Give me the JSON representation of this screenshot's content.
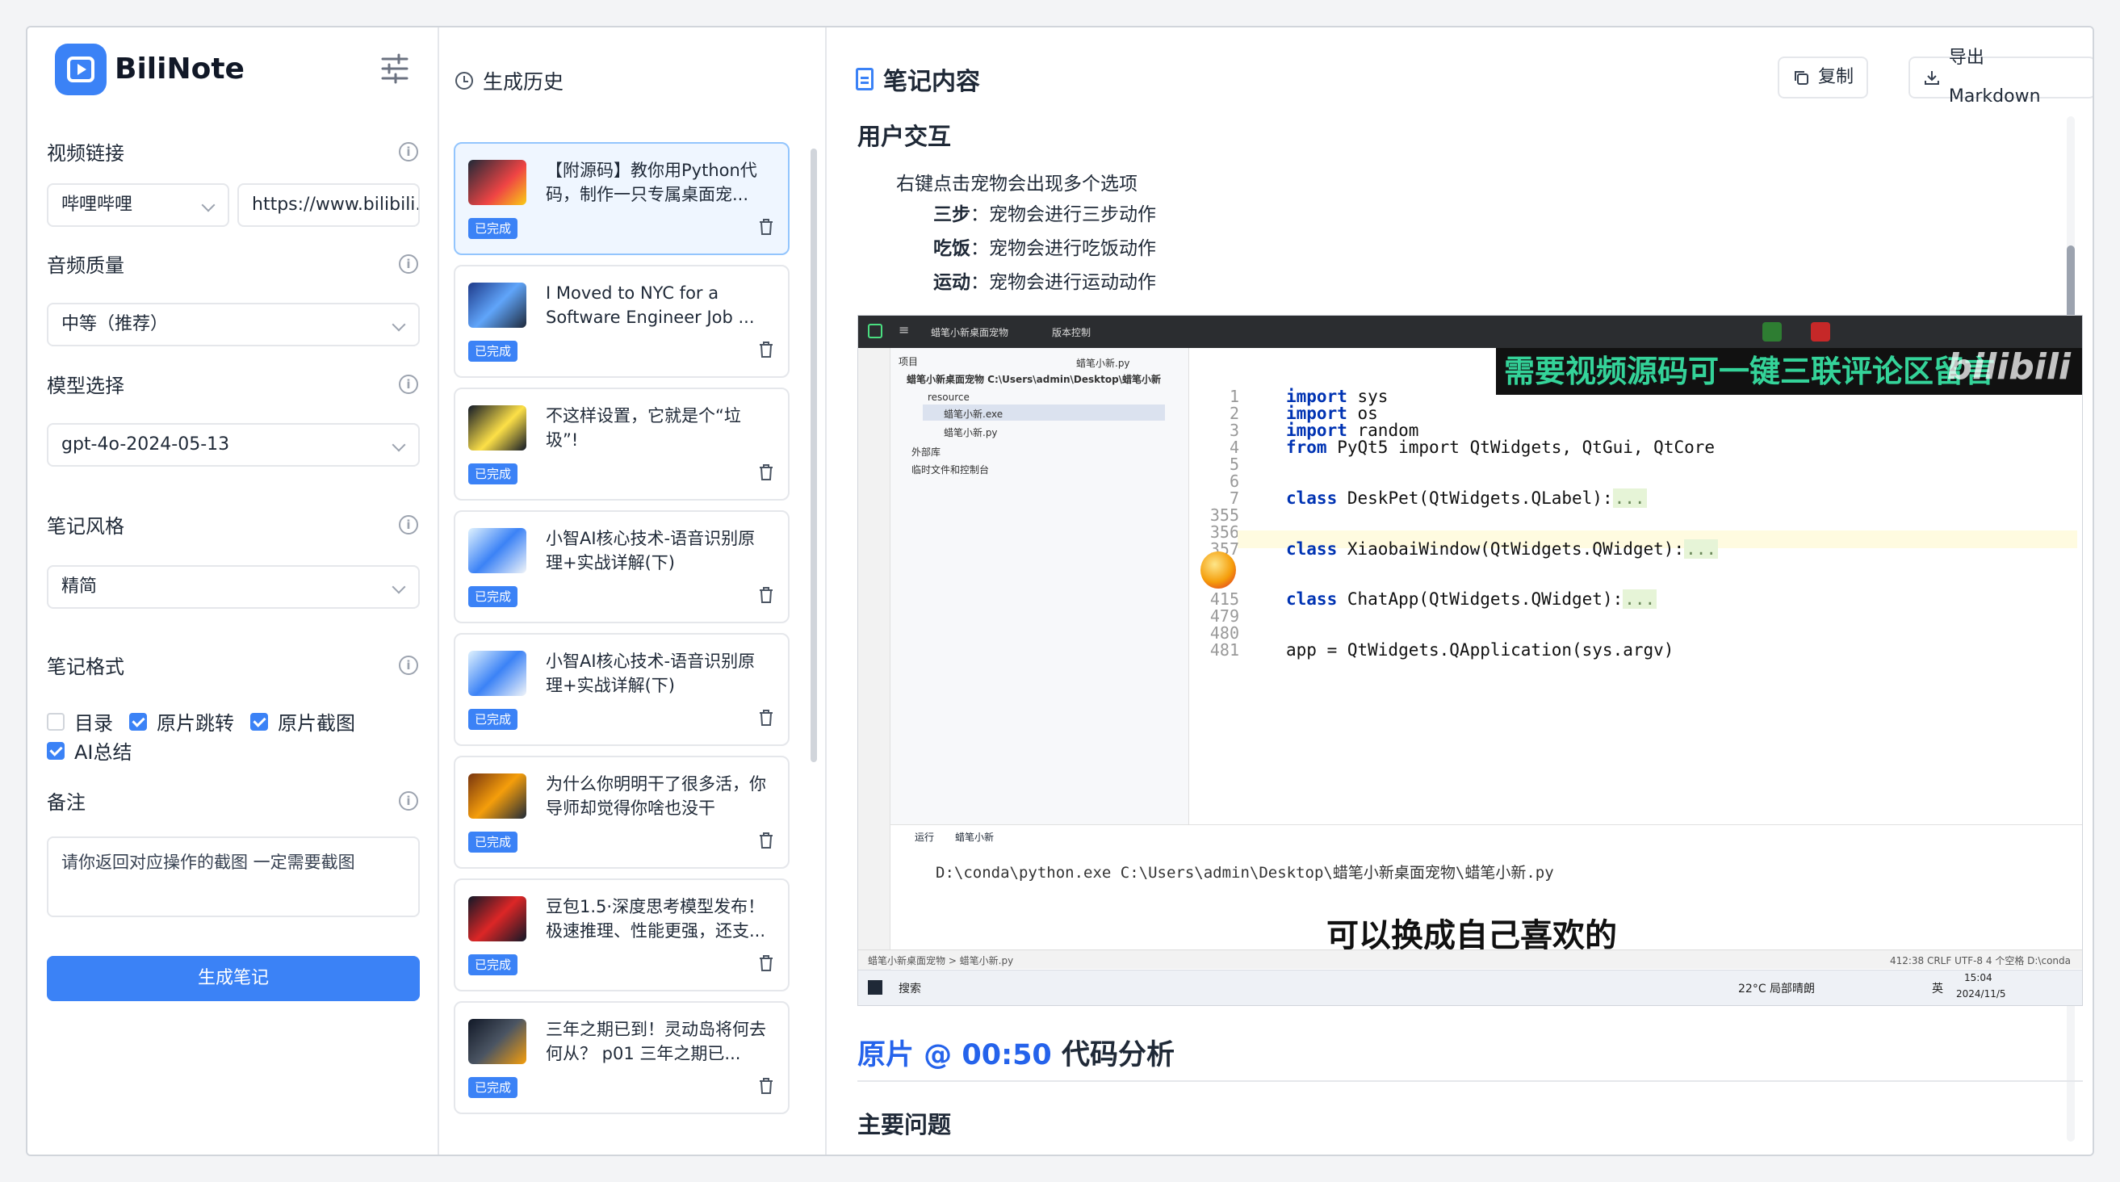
{
  "app": {
    "name": "BiliNote"
  },
  "form": {
    "video_link_label": "视频链接",
    "platform": "哔哩哔哩",
    "url_value": "https://www.bilibili.co",
    "audio_quality_label": "音频质量",
    "audio_quality": "中等（推荐）",
    "model_label": "模型选择",
    "model": "gpt-4o-2024-05-13",
    "style_label": "笔记风格",
    "style": "精简",
    "format_label": "笔记格式",
    "format_options": [
      {
        "label": "目录",
        "checked": false
      },
      {
        "label": "原片跳转",
        "checked": true
      },
      {
        "label": "原片截图",
        "checked": true
      },
      {
        "label": "AI总结",
        "checked": true
      }
    ],
    "remark_label": "备注",
    "remark_value": "请你返回对应操作的截图 一定需要截图",
    "generate_button": "生成笔记"
  },
  "history": {
    "title": "生成历史",
    "status_label": "已完成",
    "items": [
      {
        "title": "【附源码】教你用Python代码，制作一只专属桌面宠...",
        "active": true
      },
      {
        "title": "I Moved to NYC for a Software Engineer Job ...",
        "active": false
      },
      {
        "title": "不这样设置，它就是个“垃圾”!",
        "active": false
      },
      {
        "title": "小智AI核心技术-语音识别原理+实战详解(下)",
        "active": false
      },
      {
        "title": "小智AI核心技术-语音识别原理+实战详解(下)",
        "active": false
      },
      {
        "title": "为什么你明明干了很多活，你导师却觉得你啥也没干",
        "active": false
      },
      {
        "title": "豆包1.5·深度思考模型发布！极速推理、性能更强，还支...",
        "active": false
      },
      {
        "title": "三年之期已到！灵动岛将何去何从？ p01 三年之期已...",
        "active": false
      }
    ]
  },
  "note": {
    "title": "笔记内容",
    "copy_button": "复制",
    "export_button": "导出 Markdown",
    "section_heading": "用户交互",
    "bullet_main": "右键点击宠物会出现多个选项",
    "bullets": [
      {
        "key": "三步",
        "text": "：宠物会进行三步动作"
      },
      {
        "key": "吃饭",
        "text": "：宠物会进行吃饭动作"
      },
      {
        "key": "运动",
        "text": "：宠物会进行运动动作"
      }
    ],
    "clip_link": "原片 @ 00:50",
    "clip_heading": "代码分析",
    "next_heading": "主要问题"
  },
  "screenshot": {
    "project_name": "蜡笔小新桌面宠物",
    "vcs": "版本控制",
    "tab_file": "蜡笔小新.py",
    "tree": [
      "项目",
      "蜡笔小新桌面宠物  C:\\Users\\admin\\Desktop\\蜡笔小新",
      "resource",
      "蜡笔小新.exe",
      "蜡笔小新.py",
      "外部库",
      "临时文件和控制台"
    ],
    "code_lines": [
      {
        "n": "1",
        "code": "sys",
        "kw": "import"
      },
      {
        "n": "2",
        "code": "os",
        "kw": "import"
      },
      {
        "n": "3",
        "code": "random",
        "kw": "import"
      },
      {
        "n": "4",
        "code": "PyQt5 import QtWidgets, QtGui, QtCore",
        "kw": "from"
      },
      {
        "n": "5",
        "code": "",
        "kw": ""
      },
      {
        "n": "6",
        "code": "",
        "kw": ""
      },
      {
        "n": "7",
        "code": "DeskPet(QtWidgets.QLabel):",
        "kw": "class"
      },
      {
        "n": "355",
        "code": "",
        "kw": ""
      },
      {
        "n": "356",
        "code": "",
        "kw": ""
      },
      {
        "n": "357",
        "code": "XiaobaiWindow(QtWidgets.QWidget):",
        "kw": "class"
      },
      {
        "n": "415",
        "code": "ChatApp(QtWidgets.QWidget):",
        "kw": "class"
      },
      {
        "n": "479",
        "code": "",
        "kw": ""
      },
      {
        "n": "480",
        "code": "",
        "kw": ""
      },
      {
        "n": "481",
        "code": "app = QtWidgets.QApplication(sys.argv)",
        "kw": ""
      }
    ],
    "fold_text": "...",
    "banner_text": "需要视频源码可一键三联评论区留言",
    "watermark": "bilibili",
    "run_tab": "运行",
    "run_config": "蜡笔小新",
    "run_command": "D:\\conda\\python.exe C:\\Users\\admin\\Desktop\\蜡笔小新桌面宠物\\蜡笔小新.py",
    "subtitle": "可以换成自己喜欢的",
    "status_path": "蜡笔小新桌面宠物 > 蜡笔小新.py",
    "status_right": "412:38   CRLF   UTF-8   4 个空格   D:\\conda",
    "taskbar_search": "搜索",
    "weather": "22°C 局部晴朗",
    "ime": "英",
    "time": "15:04",
    "date": "2024/11/5"
  }
}
